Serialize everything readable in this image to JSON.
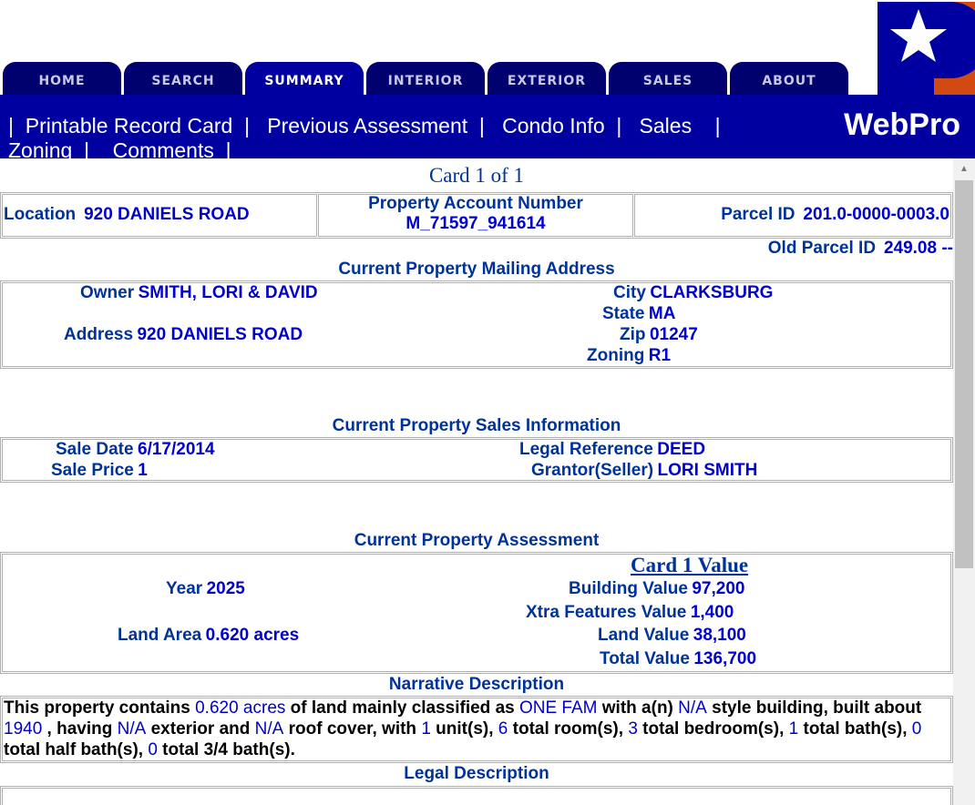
{
  "tabs": [
    "HOME",
    "SEARCH",
    "SUMMARY",
    "INTERIOR",
    "EXTERIOR",
    "SALES",
    "ABOUT"
  ],
  "nav": {
    "links_line1": [
      "Printable Record Card",
      "Previous Assessment",
      "Condo Info",
      "Sales"
    ],
    "links_line2": [
      "Zoning",
      "Comments"
    ],
    "sep": "|",
    "brand": "WebPro"
  },
  "card_label": "Card 1 of 1",
  "top": {
    "location_label": "Location",
    "location": "920 DANIELS ROAD",
    "account_label": "Property Account Number",
    "account": "M_71597_941614",
    "parcel_label": "Parcel ID",
    "parcel": "201.0-0000-0003.0",
    "old_parcel_label": "Old Parcel ID",
    "old_parcel": "249.08 --"
  },
  "mailing": {
    "title": "Current Property Mailing Address",
    "owner_label": "Owner",
    "owner": "SMITH, LORI & DAVID",
    "address_label": "Address",
    "address": "920 DANIELS ROAD",
    "city_label": "City",
    "city": "CLARKSBURG",
    "state_label": "State",
    "state": "MA",
    "zip_label": "Zip",
    "zip": "01247",
    "zoning_label": "Zoning",
    "zoning": "R1"
  },
  "sales": {
    "title": "Current Property Sales Information",
    "date_label": "Sale Date",
    "date": "6/17/2014",
    "price_label": "Sale Price",
    "price": "1",
    "legal_label": "Legal Reference",
    "legal": "DEED",
    "grantor_label": "Grantor(Seller)",
    "grantor": "LORI SMITH"
  },
  "assessment": {
    "title": "Current Property Assessment",
    "card_value": "Card 1 Value",
    "year_label": "Year",
    "year": "2025",
    "land_area_label": "Land Area",
    "land_area": "0.620 acres",
    "building_label": "Building Value",
    "building": "97,200",
    "xtra_label": "Xtra Features Value",
    "xtra": "1,400",
    "land_label": "Land Value",
    "land": "38,100",
    "total_label": "Total Value",
    "total": "136,700"
  },
  "narrative": {
    "title": "Narrative Description",
    "t1": "This property contains ",
    "acres": "0.620 acres",
    "t2": " of land mainly classified as ",
    "cls": "ONE FAM",
    "t3": " with a(n) ",
    "style": "N/A",
    "t4": " style building, built about",
    "year": "1940",
    "t5": " , having ",
    "ext": "N/A",
    "t6": " exterior and ",
    "roof": "N/A",
    "t7": " roof cover, with ",
    "units": "1",
    "t8": " unit(s), ",
    "rooms": "6",
    "t9": " total room(s), ",
    "beds": "3",
    "t10": " total bedroom(s), ",
    "baths": "1",
    "t11": " total bath(s), ",
    "half": "0",
    "t12": "total half bath(s), ",
    "three4": "0",
    "t13": " total 3/4 bath(s)."
  },
  "legal_title": "Legal Description"
}
